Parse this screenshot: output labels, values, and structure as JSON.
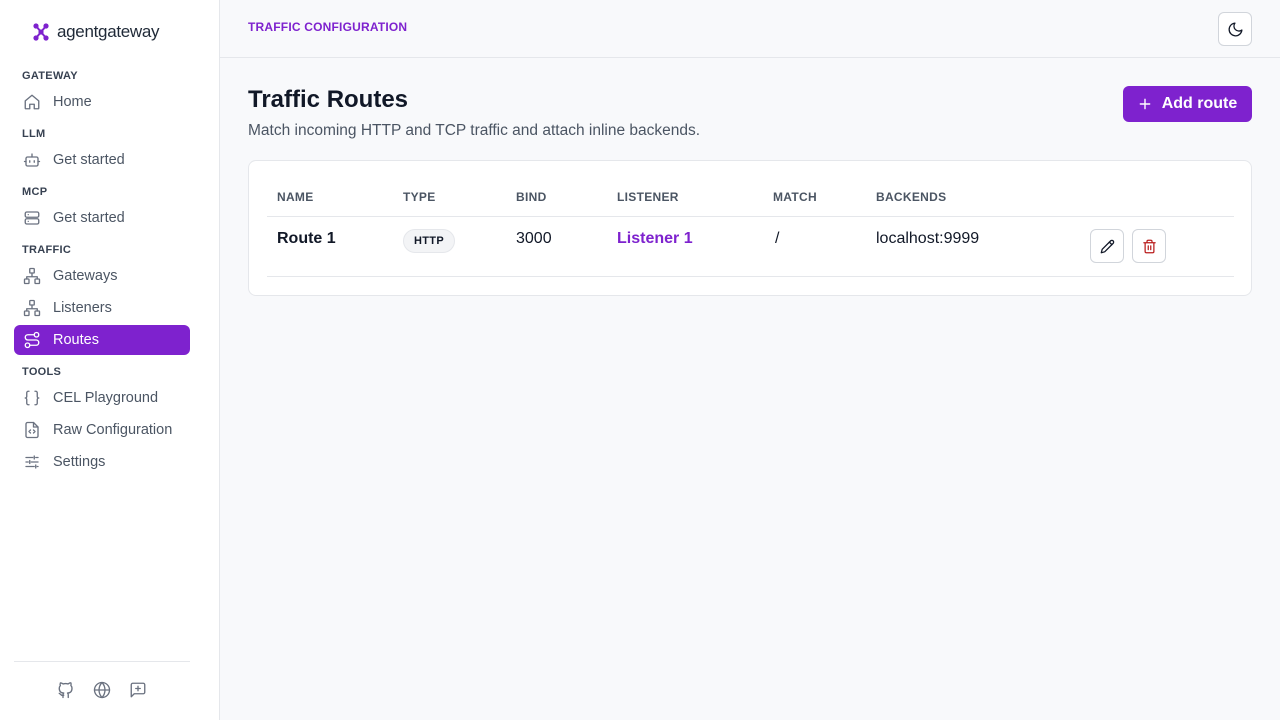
{
  "brand": {
    "name": "agentgateway",
    "accent": "#7e22ce"
  },
  "sidebar": {
    "sections": [
      {
        "title": "GATEWAY"
      },
      {
        "title": "LLM"
      },
      {
        "title": "MCP"
      },
      {
        "title": "TRAFFIC"
      },
      {
        "title": "TOOLS"
      }
    ],
    "items": [
      {
        "label": "Home",
        "icon": "home-icon"
      },
      {
        "label": "Get started",
        "icon": "bot-icon"
      },
      {
        "label": "Get started",
        "icon": "server-icon"
      },
      {
        "label": "Gateways",
        "icon": "network-icon"
      },
      {
        "label": "Listeners",
        "icon": "network-icon"
      },
      {
        "label": "Routes",
        "icon": "route-icon",
        "active": true
      },
      {
        "label": "CEL Playground",
        "icon": "braces-icon"
      },
      {
        "label": "Raw Configuration",
        "icon": "file-code-icon"
      },
      {
        "label": "Settings",
        "icon": "sliders-icon"
      }
    ],
    "footer_icons": [
      "github-icon",
      "globe-icon",
      "message-plus-icon"
    ]
  },
  "header": {
    "breadcrumb": "TRAFFIC CONFIGURATION",
    "theme_toggle_icon": "moon-icon"
  },
  "main": {
    "title": "Traffic Routes",
    "subtitle": "Match incoming HTTP and TCP traffic and attach inline backends.",
    "add_button_label": "Add route",
    "table": {
      "columns": [
        "NAME",
        "TYPE",
        "BIND",
        "LISTENER",
        "MATCH",
        "BACKENDS"
      ],
      "rows": [
        {
          "name": "Route 1",
          "type": "HTTP",
          "bind": "3000",
          "listener": "Listener 1",
          "match": "/",
          "backends": "localhost:9999"
        }
      ]
    }
  },
  "colors": {
    "accent": "#7e22ce",
    "delete": "#b91c1c",
    "background": "#f8f9fb"
  }
}
